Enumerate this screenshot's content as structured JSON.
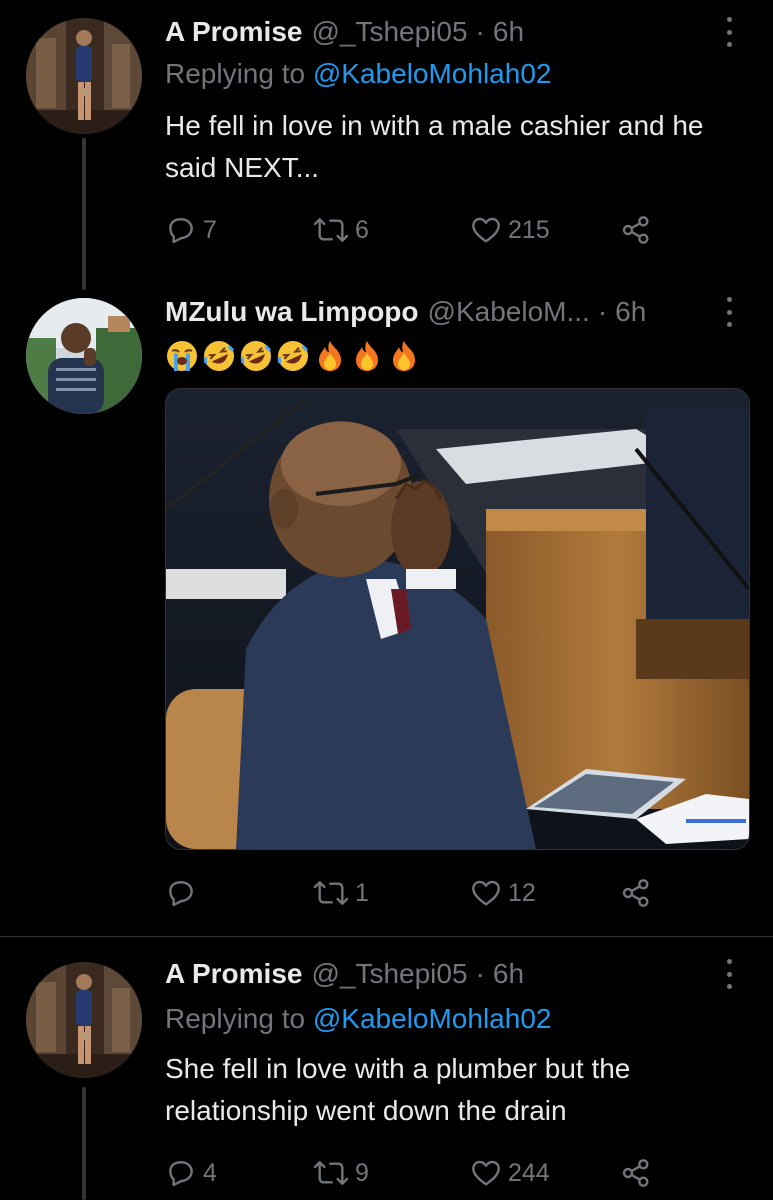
{
  "tweets": [
    {
      "name": "A Promise",
      "handle": "@_Tshepi05",
      "time": "6h",
      "replying_label": "Replying to",
      "replying_mention": "@KabeloMohlah02",
      "text": "He fell in love in with a male cashier and he said NEXT...",
      "replies": "7",
      "retweets": "6",
      "likes": "215"
    },
    {
      "name": "MZulu wa Limpopo",
      "handle": "@KabeloM...",
      "time": "6h",
      "emoji_text": "😭🤣🤣🤣🔥🔥🔥",
      "emojis": [
        "crying-face",
        "rofl-face",
        "rofl-face",
        "rofl-face",
        "fire",
        "fire",
        "fire"
      ],
      "replies": "",
      "retweets": "1",
      "likes": "12"
    },
    {
      "name": "A Promise",
      "handle": "@_Tshepi05",
      "time": "6h",
      "replying_label": "Replying to",
      "replying_mention": "@KabeloMohlah02",
      "text": "She fell in love with a plumber but the relationship went down the drain",
      "replies": "4",
      "retweets": "9",
      "likes": "244"
    }
  ],
  "theme": {
    "background": "#000000",
    "text": "#e7e9ea",
    "secondary": "#71767b",
    "link": "#1d9bf0",
    "divider": "#2f3336"
  },
  "icons": [
    "reply-icon",
    "retweet-icon",
    "like-icon",
    "share-icon",
    "more-icon"
  ]
}
